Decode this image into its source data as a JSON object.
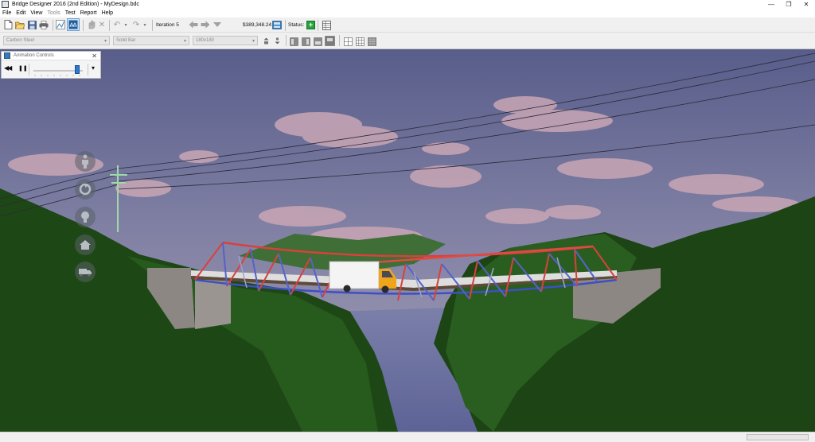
{
  "window": {
    "title": "Bridge Designer 2016 (2nd Edition) - MyDesign.bdc",
    "min_glyph": "—",
    "max_glyph": "❐",
    "close_glyph": "✕"
  },
  "menu": {
    "items": [
      {
        "label": "File",
        "enabled": true
      },
      {
        "label": "Edit",
        "enabled": true
      },
      {
        "label": "View",
        "enabled": true
      },
      {
        "label": "Tools",
        "enabled": false
      },
      {
        "label": "Test",
        "enabled": true
      },
      {
        "label": "Report",
        "enabled": true
      },
      {
        "label": "Help",
        "enabled": true
      }
    ]
  },
  "toolbar": {
    "iteration_label": "Iteration 5",
    "cost": "$389,348.24",
    "status_label": "Status:",
    "undo_glyph": "↶",
    "redo_glyph": "↷",
    "dropdown_glyph": "▾",
    "delete_glyph": "✕",
    "status_icon_glyph": "+",
    "colors": {
      "status_ok": "#22a63a",
      "disabled_icon": "#9a9a9a",
      "active_icon": "#3b82c4"
    }
  },
  "toolbar2": {
    "material": "Carbon Steel",
    "section": "Solid Bar",
    "size": "180x180",
    "dropdown_glyph": "▾"
  },
  "animation_controls": {
    "title": "Animation Controls",
    "close_glyph": "✕",
    "rewind_glyph": "◀◀",
    "pause_glyph": "❚❚",
    "menu_glyph": "▾",
    "speed_level": 0.93
  },
  "scene": {
    "colors": {
      "sky_top": "#5a5f8c",
      "sky_mid": "#8585a8",
      "sky_bottom": "#a29db6",
      "cloud": "#c8a9b8",
      "hill_dark": "#1c4414",
      "hill_mid": "#295a1f",
      "hill_far": "#44783a",
      "water": "#6d74a5",
      "compression_member": "#d8413c",
      "tension_member": "#4e5dc8",
      "deck": "#dcdcdc",
      "abutment": "#8a8682",
      "truck_box": "#f4f4f4",
      "truck_cab": "#f0a41c"
    },
    "nav_icons": [
      "person-icon",
      "rotate-icon",
      "head-icon",
      "home-icon",
      "truck-icon"
    ]
  }
}
